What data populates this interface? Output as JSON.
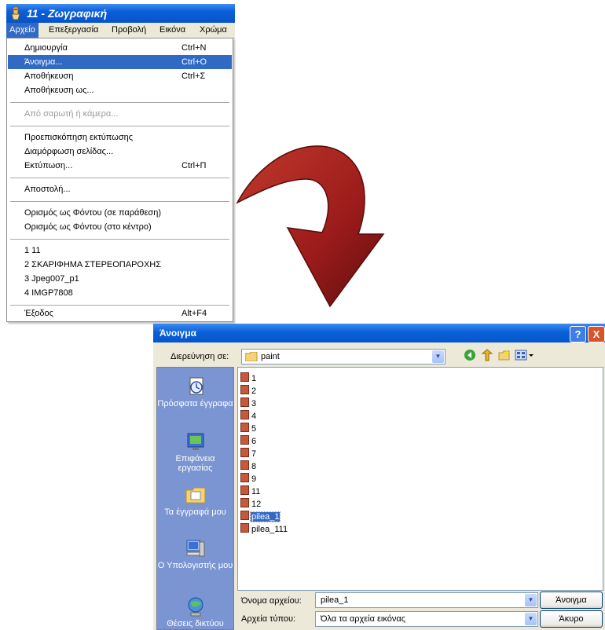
{
  "paint": {
    "title": "11 - Ζωγραφική",
    "menubar": [
      "Αρχείο",
      "Επεξεργασία",
      "Προβολή",
      "Εικόνα",
      "Χρώμα"
    ],
    "menu": [
      {
        "label": "Δημιουργία",
        "shortcut": "Ctrl+N"
      },
      {
        "label": "Άνοιγμα...",
        "shortcut": "Ctrl+O"
      },
      {
        "label": "Αποθήκευση",
        "shortcut": "Ctrl+Σ"
      },
      {
        "label": "Αποθήκευση ως...",
        "shortcut": ""
      },
      {
        "label": "Από σαρωτή ή κάμερα...",
        "shortcut": ""
      },
      {
        "label": "Προεπισκόπηση εκτύπωσης",
        "shortcut": ""
      },
      {
        "label": "Διαμόρφωση σελίδας...",
        "shortcut": ""
      },
      {
        "label": "Εκτύπωση...",
        "shortcut": "Ctrl+Π"
      },
      {
        "label": "Αποστολή...",
        "shortcut": ""
      },
      {
        "label": "Ορισμός ως Φόντου (σε παράθεση)",
        "shortcut": ""
      },
      {
        "label": "Ορισμός ως Φόντου (στο κέντρο)",
        "shortcut": ""
      },
      {
        "label": "1 11",
        "shortcut": ""
      },
      {
        "label": "2 ΣΚΑΡΙΦΗΜΑ ΣΤΕΡΕΟΠΑΡΟΧΗΣ",
        "shortcut": ""
      },
      {
        "label": "3 Jpeg007_p1",
        "shortcut": ""
      },
      {
        "label": "4 IMGP7808",
        "shortcut": ""
      },
      {
        "label": "Έξοδος",
        "shortcut": "Alt+F4"
      }
    ]
  },
  "dialog": {
    "title": "Άνοιγμα",
    "help": "?",
    "close": "X",
    "look_in_label": "Διερεύνηση σε:",
    "look_in_value": "paint",
    "places": [
      "Πρόσφατα έγγραφα",
      "Επιφάνεια εργασίας",
      "Τα έγγραφά μου",
      "Ο Υπολογιστής μου",
      "Θέσεις δικτύου"
    ],
    "files": [
      "1",
      "2",
      "3",
      "4",
      "5",
      "6",
      "7",
      "8",
      "9",
      "11",
      "12",
      "pilea_1",
      "pilea_111"
    ],
    "selected_file": "pilea_1",
    "filename_label": "Όνομα αρχείου:",
    "filename_value": "pilea_1",
    "filetype_label": "Αρχεία τύπου:",
    "filetype_value": "Όλα τα αρχεία εικόνας",
    "open_button": "Άνοιγμα",
    "cancel_button": "Άκυρο"
  },
  "colors": {
    "titlebar": "#0a5fd8",
    "highlight": "#316ac5",
    "arrow": "#9b1b1b"
  }
}
